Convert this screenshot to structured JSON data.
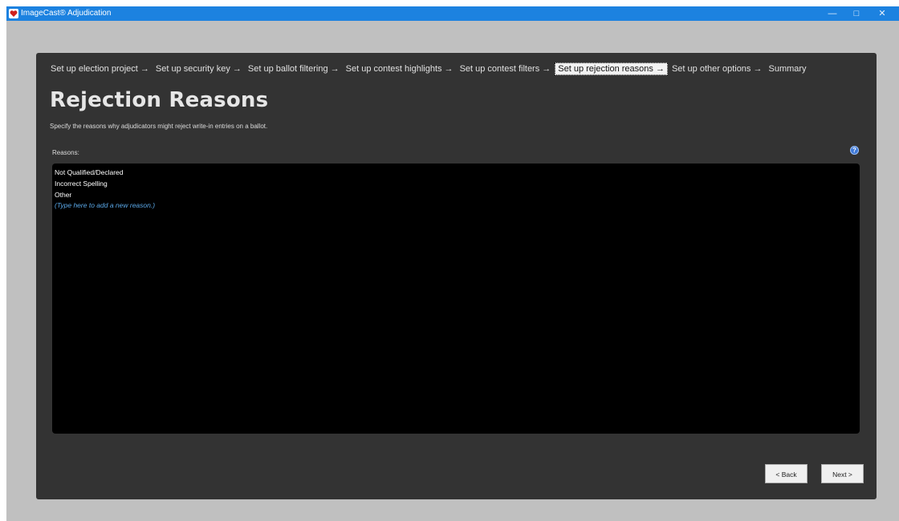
{
  "window": {
    "title": "ImageCast® Adjudication",
    "icon": "imagecast-app-icon",
    "controls": {
      "minimize": "—",
      "maximize": "□",
      "close": "✕"
    }
  },
  "wizard": {
    "steps": [
      {
        "label": "Set up election project →",
        "active": false
      },
      {
        "label": "Set up security key →",
        "active": false
      },
      {
        "label": "Set up ballot filtering →",
        "active": false
      },
      {
        "label": "Set up contest highlights →",
        "active": false
      },
      {
        "label": "Set up contest filters →",
        "active": false
      },
      {
        "label": "Set up rejection reasons →",
        "active": true
      },
      {
        "label": "Set up other options →",
        "active": false
      },
      {
        "label": "Summary",
        "active": false
      }
    ]
  },
  "page": {
    "title": "Rejection Reasons",
    "subtitle": "Specify the reasons why adjudicators might reject write-in entries on a ballot.",
    "reasons_label": "Reasons:",
    "help_glyph": "?"
  },
  "reasons": {
    "items": [
      "Not Qualified/Declared",
      "Incorrect Spelling",
      "Other"
    ],
    "new_placeholder": "(Type here to add a new reason.)"
  },
  "buttons": {
    "back": "< Back",
    "next": "Next >"
  },
  "colors": {
    "titlebar": "#1c82e0",
    "panel": "#333333",
    "list_bg": "#000000",
    "placeholder": "#5aa8e8"
  }
}
